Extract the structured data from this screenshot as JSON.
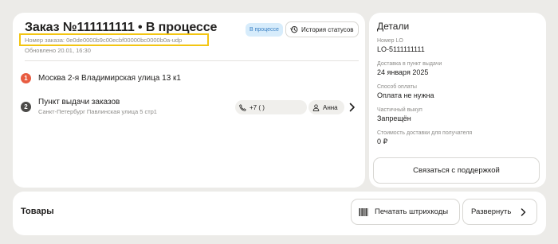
{
  "order": {
    "title": "Заказ №111111111 • В процессе",
    "status_badge": "В процессе",
    "history_button": "История статусов",
    "number_line": "Номер заказа: 0e0de0000b9c00ecbf00000bc0000b0a-udp",
    "updated": "Обновлено 20.01, 16:30",
    "points": [
      {
        "index": "1",
        "title": "Москва 2-я Владимирская улица 13 к1",
        "subtitle": "",
        "color": "#e85c41"
      },
      {
        "index": "2",
        "title": "Пункт выдачи заказов",
        "subtitle": "Санкт-Петербург Павлинская улица 5 стр1",
        "color": "#4c4b49"
      }
    ],
    "phone": "+7 (     )",
    "contact_name": "Анна",
    "highlight_color": "#f3c512"
  },
  "details": {
    "heading": "Детали",
    "fields": [
      {
        "label": "Номер LO",
        "value": "LO-5111111111"
      },
      {
        "label": "Доставка в пункт выдачи",
        "value": "24 января 2025"
      },
      {
        "label": "Способ оплаты",
        "value": "Оплата не нужна"
      },
      {
        "label": "Частичный выкуп",
        "value": "Запрещён"
      },
      {
        "label": "Стоимость доставки для получателя",
        "value": "0 ₽"
      }
    ],
    "support_button": "Связаться с поддержкой"
  },
  "goods": {
    "title": "Товары",
    "print_button": "Печатать штрихкоды",
    "expand_button": "Развернуть"
  },
  "icons": {
    "history": "history-icon",
    "phone": "phone-icon",
    "person": "person-icon",
    "chevron": "chevron-right-icon",
    "barcode": "barcode-icon"
  }
}
